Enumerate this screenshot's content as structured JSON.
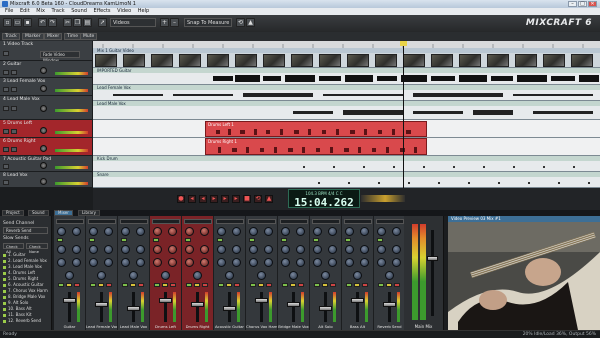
{
  "window": {
    "title": "Mixcraft 6.0 Beta 160 - CloudDreams KamLimoN 1",
    "minimize": "–",
    "maximize": "□",
    "close": "✕"
  },
  "menu": [
    "File",
    "Edit",
    "Mix",
    "Track",
    "Sound",
    "Effects",
    "Video",
    "Help"
  ],
  "toolbar": {
    "view_select": "Videos",
    "snap_select": "Snap To Measure",
    "logo": "MIXCRAFT 6"
  },
  "view_tabs": [
    "Track",
    "Marker",
    "Mixer",
    "Time",
    "Mute"
  ],
  "track_headers": [
    {
      "name": "1 Video Track",
      "sub": "Fade Video Window",
      "color": "#3b3f43"
    },
    {
      "name": "2 Guitar",
      "color": "#3b3f43"
    },
    {
      "name": "3 Lead Female Vox",
      "color": "#3b3f43"
    },
    {
      "name": "4 Lead Male Vox",
      "color": "#3b3f43"
    },
    {
      "name": "5 Drums Left",
      "color": "#a3262b"
    },
    {
      "name": "6 Drums Right",
      "color": "#a3262b"
    },
    {
      "name": "7 Acoustic Guitar Pad",
      "color": "#3b3f43"
    },
    {
      "name": "8 Lead Vox",
      "color": "#3b3f43"
    }
  ],
  "lanes": {
    "video_clip": "Mix 1 Guitar Video",
    "guitar_clip": "IMPORTED Guitar",
    "lead_female_clip": "Lead Female Vox",
    "lead_male_clip": "Lead Male Vox",
    "drums_left_clip": "Drums Left 1",
    "drums_right_clip": "Drums Right 1",
    "kick_clip": "Kick Drum",
    "snare_clip": "Snare"
  },
  "transport": {
    "tempo_line": "104.3 BPM  4/4 C  C",
    "time": "15:04.262"
  },
  "mixer": {
    "tabs": [
      "Project",
      "Sound",
      "Mixer",
      "Library"
    ],
    "send_title": "Send Channel",
    "send_select": "Reverb Send",
    "bus": "Slow Sends",
    "send_buttons": [
      "Check All",
      "Check None"
    ],
    "send_items": [
      "1. Guitar",
      "2. Lead Female Vox",
      "3. Lead Male Vox",
      "4. Drums Left",
      "5. Drums Right",
      "6. Acoustic Guitar",
      "7. Chorus Vox Harm",
      "8. Bridge Male Vox",
      "9. Alt Solo",
      "10. Bass Alt",
      "11. Bass Kit",
      "12. Reverb Send"
    ],
    "strips": [
      {
        "name": "Guitar",
        "color": "normal"
      },
      {
        "name": "Lead Female Vox",
        "color": "normal"
      },
      {
        "name": "Lead Male Vox",
        "color": "normal"
      },
      {
        "name": "Drums Left",
        "color": "red"
      },
      {
        "name": "Drums Right",
        "color": "red"
      },
      {
        "name": "Acoustic Guitar",
        "color": "normal"
      },
      {
        "name": "Chorus Vox Harm",
        "color": "normal"
      },
      {
        "name": "Bridge Male Vox",
        "color": "normal"
      },
      {
        "name": "Alt Solo",
        "color": "normal"
      },
      {
        "name": "Bass Alt",
        "color": "normal"
      },
      {
        "name": "Reverb Send",
        "color": "normal"
      }
    ],
    "master": "Main Mix"
  },
  "video_panel": {
    "title": "Video Preview 03 Mix #1"
  },
  "status": {
    "left": "Ready",
    "right": "20% Idle/Load 36%, Output 56%"
  }
}
